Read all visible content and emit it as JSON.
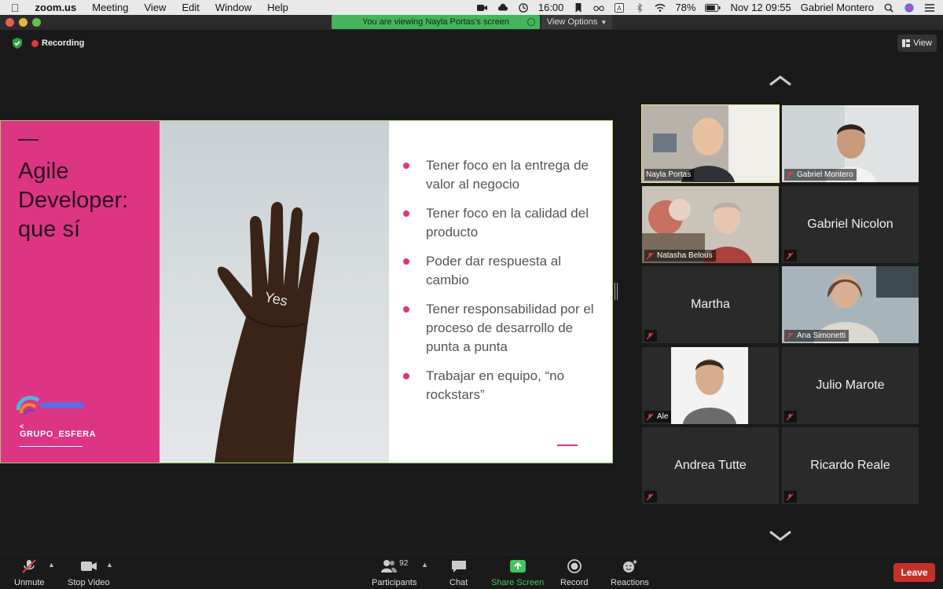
{
  "menubar": {
    "app_name": "zoom.us",
    "menus": [
      "Meeting",
      "View",
      "Edit",
      "Window",
      "Help"
    ],
    "time_widget": "16:00",
    "battery": "78%",
    "datetime": "Nov 12  09:55",
    "user": "Gabriel Montero"
  },
  "share_banner": {
    "text": "You are viewing Nayla Portas's screen",
    "view_options": "View Options"
  },
  "meeting": {
    "recording_label": "Recording",
    "view_label": "View"
  },
  "slide": {
    "title": "Agile Developer: que sí",
    "hand_text": "Yes",
    "bullets": [
      "Tener foco en la entrega de valor al negocio",
      "Tener foco en la calidad del producto",
      "Poder dar respuesta al cambio",
      "Tener responsabilidad por el proceso de desarrollo de punta a punta",
      "Trabajar en equipo, “no rockstars”"
    ],
    "logo_text": "GRUPO_ESFERA",
    "logo_mark": "<"
  },
  "participants_gallery": [
    {
      "name": "Nayla Portas",
      "video": true,
      "muted": false,
      "active": true
    },
    {
      "name": "Gabriel Montero",
      "video": true,
      "muted": true,
      "active": false
    },
    {
      "name": "Natasha Belous",
      "video": true,
      "muted": true,
      "active": false
    },
    {
      "name": "Gabriel Nicolon",
      "video": false,
      "muted": true,
      "active": false
    },
    {
      "name": "Martha",
      "video": false,
      "muted": true,
      "active": false
    },
    {
      "name": "Ana Simonetti",
      "video": true,
      "muted": true,
      "active": false
    },
    {
      "name": "Ale",
      "video": true,
      "muted": true,
      "active": false
    },
    {
      "name": "Julio Marote",
      "video": false,
      "muted": true,
      "active": false
    },
    {
      "name": "Andrea Tutte",
      "video": false,
      "muted": true,
      "active": false
    },
    {
      "name": "Ricardo Reale",
      "video": false,
      "muted": true,
      "active": false
    }
  ],
  "toolbar": {
    "unmute": "Unmute",
    "stop_video": "Stop Video",
    "participants": "Participants",
    "participants_count": "92",
    "chat": "Chat",
    "share_screen": "Share Screen",
    "record": "Record",
    "reactions": "Reactions",
    "leave": "Leave"
  },
  "colors": {
    "slide_pink": "#dc3584",
    "share_green": "#45b45c",
    "active_speaker": "#e8e884",
    "leave_red": "#c53128"
  }
}
